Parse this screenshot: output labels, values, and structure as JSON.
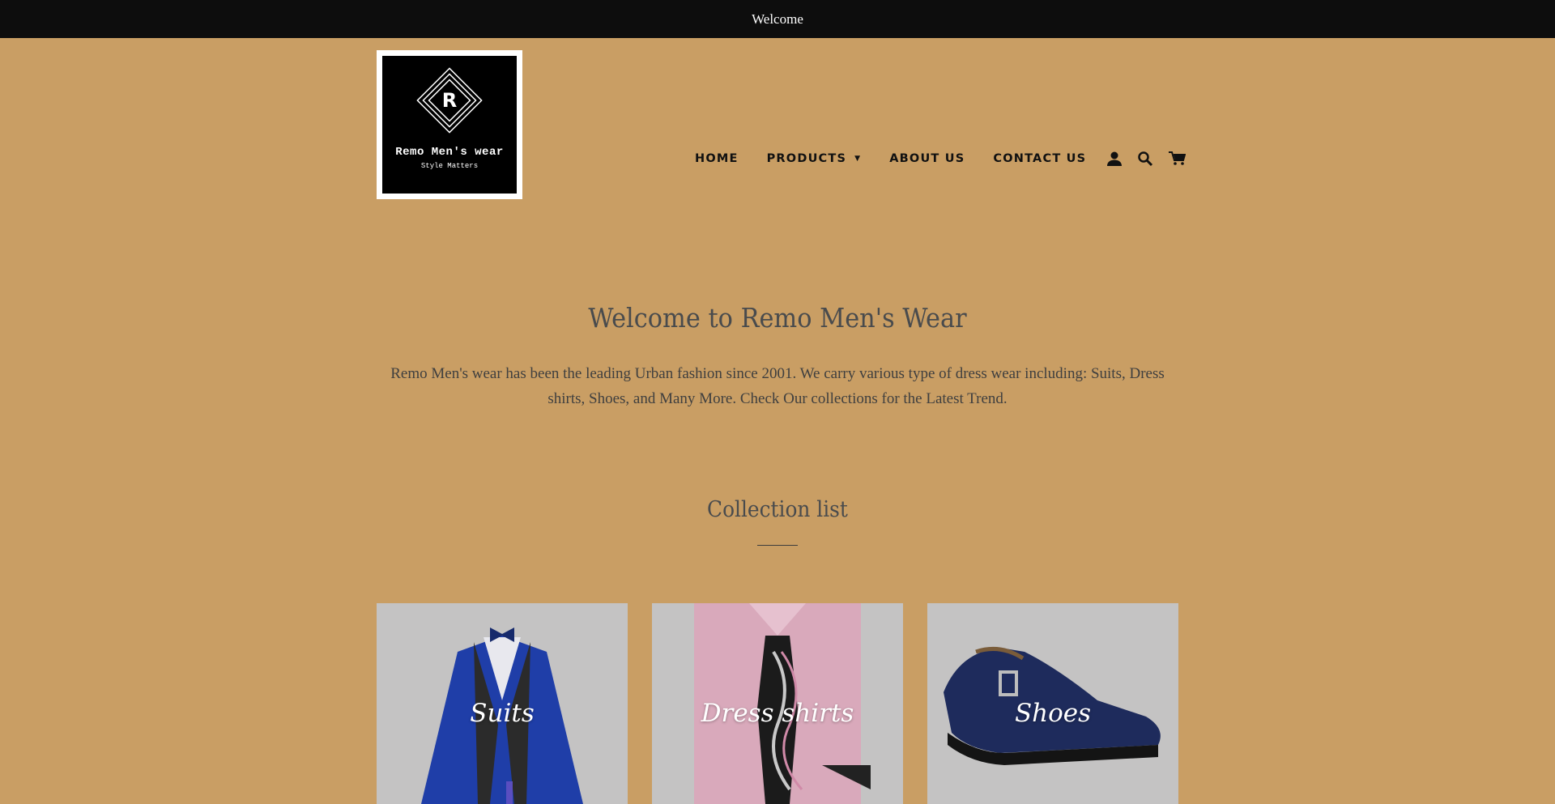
{
  "announcement": {
    "text": "Welcome"
  },
  "logo": {
    "letter": "R",
    "name": "Remo Men's wear",
    "tagline": "Style Matters"
  },
  "nav": {
    "items": [
      "HOME",
      "PRODUCTS",
      "ABOUT US",
      "CONTACT US"
    ],
    "icons": [
      "account-icon",
      "search-icon",
      "cart-icon"
    ]
  },
  "intro": {
    "title": "Welcome to Remo Men's Wear",
    "body": "Remo Men's wear has been the leading  Urban fashion since 2001. We carry various type of dress wear including: Suits, Dress shirts, Shoes, and Many More. Check Our collections for the Latest Trend."
  },
  "collection": {
    "title": "Collection list",
    "cards": [
      "Suits",
      "Dress shirts",
      "Shoes"
    ]
  },
  "colors": {
    "page_bg": "#c99e64",
    "announce_bg": "#0d0d0d",
    "card_bg": "#c4c3c3"
  }
}
